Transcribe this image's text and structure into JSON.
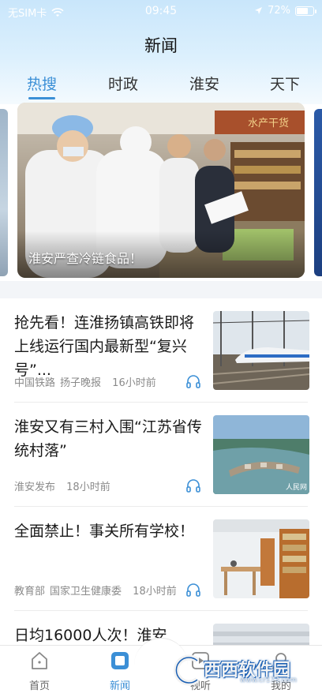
{
  "status_bar": {
    "carrier": "无SIM卡",
    "time": "09:45",
    "battery_pct": "72%",
    "battery_level": 0.72
  },
  "header": {
    "title": "新闻"
  },
  "tabs": [
    {
      "label": "热搜",
      "active": true
    },
    {
      "label": "时政",
      "active": false
    },
    {
      "label": "淮安",
      "active": false
    },
    {
      "label": "天下",
      "active": false
    }
  ],
  "banner": {
    "caption": "淮安严查冷链食品！"
  },
  "feed": [
    {
      "title": "抢先看！连淮扬镇高铁即将上线运行国内最新型“复兴号”...",
      "sources": [
        "中国铁路",
        "扬子晚报"
      ],
      "time": "16小时前",
      "thumb": "high-speed-train"
    },
    {
      "title": "淮安又有三村入围“江苏省传统村落”",
      "sources": [
        "淮安发布"
      ],
      "time": "18小时前",
      "thumb": "aerial-village"
    },
    {
      "title": "全面禁止！事关所有学校！",
      "sources": [
        "教育部",
        "国家卫生健康委"
      ],
      "time": "18小时前",
      "thumb": "library"
    },
    {
      "title": "日均16000人次！淮安",
      "sources": [],
      "time": "",
      "thumb": "station"
    }
  ],
  "bottom_nav": [
    {
      "label": "首页",
      "icon": "home-icon",
      "active": false
    },
    {
      "label": "新闻",
      "icon": "news-icon",
      "active": true
    },
    {
      "label": "视听",
      "icon": "play-icon",
      "active": false
    },
    {
      "label": "我的",
      "icon": "user-icon",
      "active": false
    }
  ],
  "watermark": {
    "text": "西西软件园",
    "url": "www.cr173.com"
  },
  "colors": {
    "accent": "#3b8fd6",
    "header_bg": "#d6eefc"
  }
}
